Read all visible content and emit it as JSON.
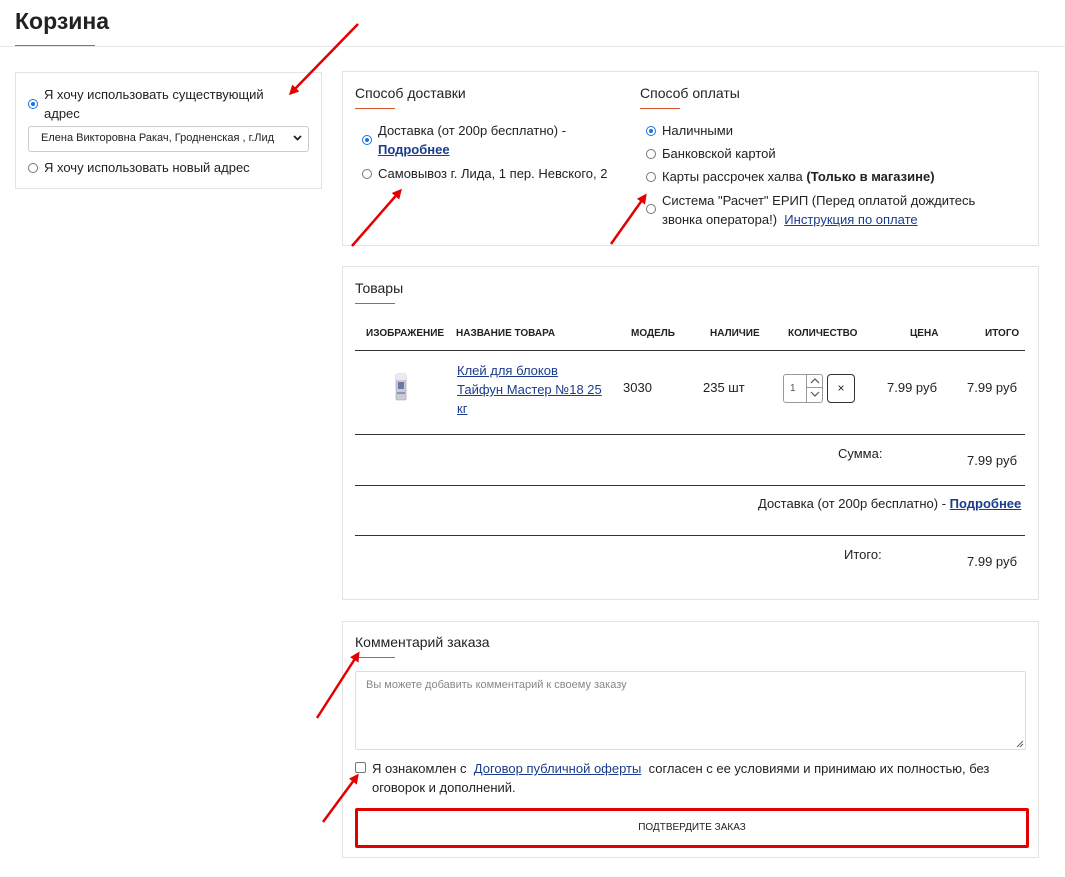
{
  "page": {
    "title": "Корзина"
  },
  "address": {
    "existing_label_line1": "Я хочу использовать существующий",
    "existing_label_line2": "адрес",
    "selected_address": "Елена Викторовна Ракач, Гродненская , г.Лид",
    "new_label": "Я хочу использовать новый адрес"
  },
  "delivery": {
    "title": "Способ доставки",
    "option1_text": "Доставка (от 200р бесплатно) -",
    "option1_link": "Подробнее",
    "option2_text": "Самовывоз г. Лида, 1 пер. Невского, 2"
  },
  "payment": {
    "title": "Способ оплаты",
    "cash": "Наличными",
    "card": "Банковской картой",
    "halva_text": "Карты рассрочек халва",
    "halva_note": "(Только в магазине",
    "erip_line1": "Система \"Расчет\" ЕРИП (Перед оплатой дождитесь",
    "erip_line2": "звонка оператора!)",
    "erip_link": "Инструкция по оплате"
  },
  "products": {
    "title": "Товары",
    "headers": {
      "image": "Изображение",
      "name": "Название товара",
      "model": "Модель",
      "stock": "Наличие",
      "qty": "Количество",
      "price": "Цена",
      "total": "Итого"
    },
    "rows": [
      {
        "name_line1": "Клей для блоков",
        "name_line2": "Тайфун Мастер №18 25",
        "name_line3": "кг",
        "model": "3030",
        "stock": "235 шт",
        "qty": "1",
        "price": "7.99 руб",
        "total": "7.99 руб"
      }
    ],
    "remove_glyph": "×",
    "summary": {
      "subtotal_label": "Сумма:",
      "subtotal_value": "7.99 руб",
      "shipping_text": "Доставка (от 200р бесплатно) -",
      "shipping_link": "Подробнее",
      "total_label": "Итого:",
      "total_value": "7.99 руб"
    }
  },
  "comment": {
    "title": "Комментарий заказа",
    "placeholder": "Вы можете добавить комментарий к своему заказу",
    "agree_prefix": "Я ознакомлен с",
    "agree_link": "Договор публичной оферты",
    "agree_suffix_line1": "согласен с ее условиями и принимаю их полностью, без",
    "agree_suffix_line2": "оговорок и дополнений.",
    "confirm_label": "Подтвердите заказ"
  },
  "colors": {
    "accent_underline": "#d9532c",
    "link": "#1a3c8e",
    "radio_checked": "#1a73e8",
    "annotation_arrow": "#e30000",
    "confirm_border": "#e30000"
  },
  "icons": {
    "select": "chevron-down-icon",
    "qty_up": "chevron-up-icon",
    "qty_down": "chevron-down-icon",
    "remove": "close-icon",
    "resize": "resize-grip-icon",
    "annotations": "red-arrow-annotation"
  }
}
